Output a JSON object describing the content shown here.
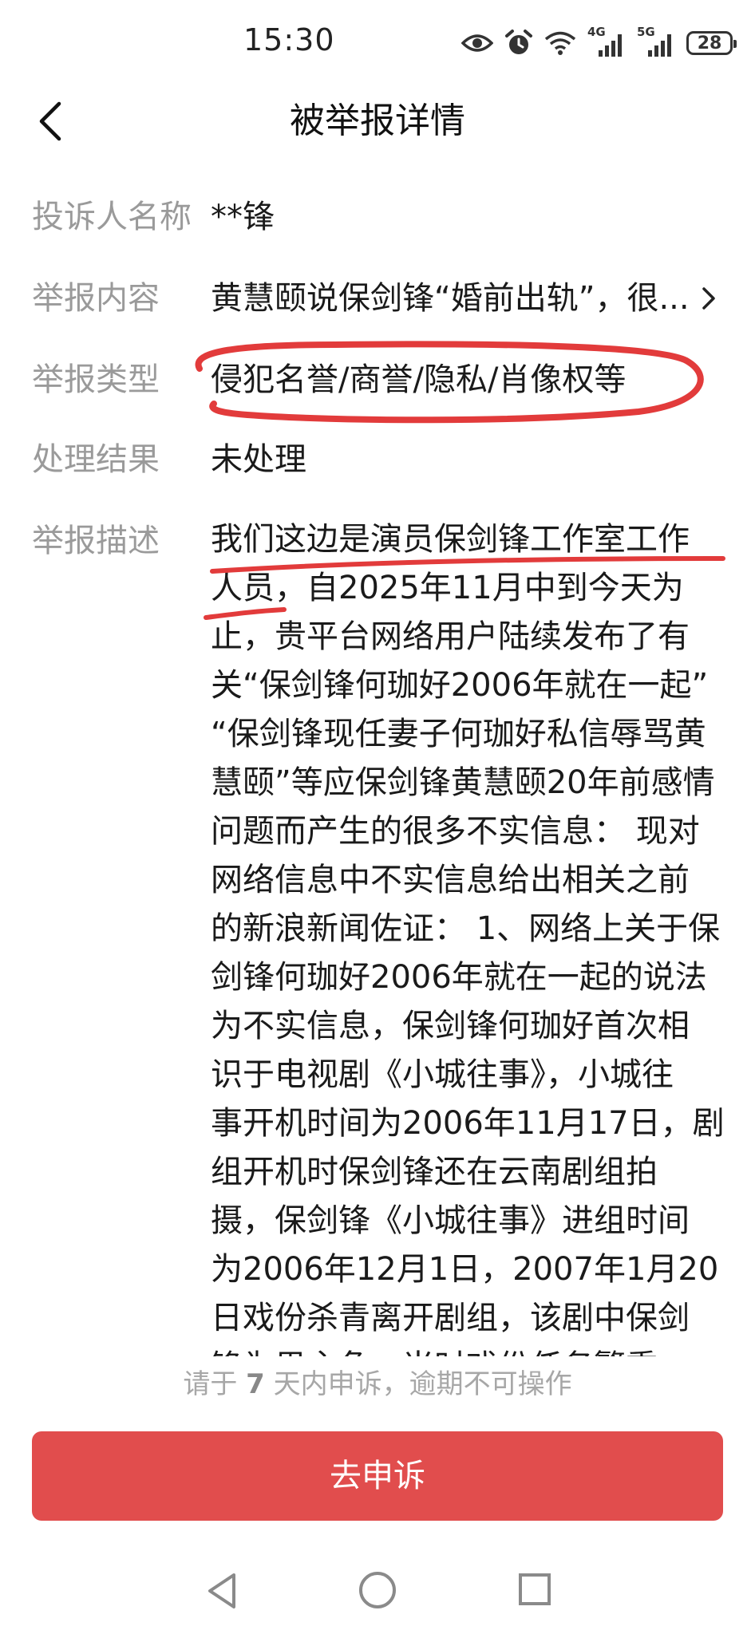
{
  "status_bar": {
    "time": "15:30",
    "icons": [
      "eye-icon",
      "alarm-icon",
      "wifi-icon",
      "signal-4g-icon",
      "signal-5g-icon"
    ],
    "network_4g": "4G",
    "network_5g": "5G",
    "battery": "28"
  },
  "header": {
    "title": "被举报详情"
  },
  "details": {
    "complainant_label": "投诉人名称",
    "complainant_value": "**锋",
    "content_label": "举报内容",
    "content_value": "黄慧颐说保剑锋“婚前出轨”，很...",
    "type_label": "举报类型",
    "type_value": "侵犯名誉/商誉/隐私/肖像权等",
    "result_label": "处理结果",
    "result_value": "未处理",
    "description_label": "举报描述",
    "description_lines": [
      "我们这边是演员保剑锋工作室工作",
      "人员，自2025年11月中到今天为",
      "止，贵平台网络用户陆续发布了有",
      "关“保剑锋何珈好2006年就在一起”",
      "“保剑锋现任妻子何珈好私信辱骂黄",
      "慧颐”等应保剑锋黄慧颐20年前感情",
      "问题而产生的很多不实信息： 现对",
      "网络信息中不实信息给出相关之前",
      "的新浪新闻佐证： 1、网络上关于保",
      "剑锋何珈好2006年就在一起的说法",
      "为不实信息，保剑锋何珈好首次相",
      "识于电视剧《小城往事》，小城往",
      "事开机时间为2006年11月17日，剧",
      "组开机时保剑锋还在云南剧组拍",
      "摄，保剑锋《小城往事》进组时间",
      "为2006年12月1日，2007年1月20",
      "日戏份杀青离开剧组，该剧中保剑",
      "锋为男主角，当时戏份任务繁重"
    ]
  },
  "footer": {
    "deadline_prefix": "请于 ",
    "deadline_days": "7",
    "deadline_suffix": " 天内申诉，逾期不可操作",
    "appeal_button": "去申诉"
  },
  "colors": {
    "accent_red": "#e14d4d",
    "marker_red": "#e23b3b",
    "label_gray": "#9a9a9a"
  }
}
